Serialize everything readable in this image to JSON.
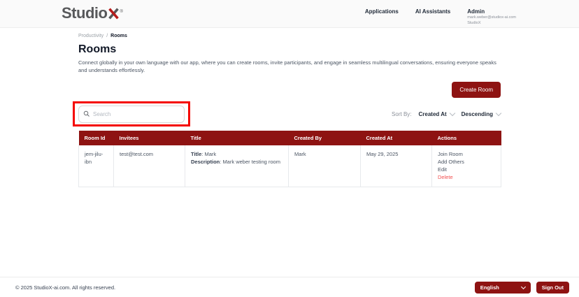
{
  "brand": {
    "name_primary": "Studio",
    "name_accent": "X",
    "registered_mark": "®"
  },
  "nav": {
    "items": [
      {
        "label": "Applications"
      },
      {
        "label": "AI Assistants"
      }
    ],
    "user": {
      "name": "Admin",
      "email": "mark.weber@studiox-ai.com",
      "org": "StudioX"
    }
  },
  "breadcrumb": {
    "parent": "Productivity",
    "separator": "/",
    "current": "Rooms"
  },
  "page": {
    "title": "Rooms",
    "description": "Connect globally in your own language with our app, where you can create rooms, invite participants, and engage in seamless multilingual conversations, ensuring everyone speaks and understands effortlessly.",
    "create_button": "Create Room"
  },
  "search": {
    "placeholder": "Search"
  },
  "sort": {
    "label": "Sort By:",
    "field": "Created At",
    "direction": "Descending"
  },
  "table": {
    "headers": [
      "Room Id",
      "Invitees",
      "Title",
      "Created By",
      "Created At",
      "Actions"
    ],
    "label_separator": ": ",
    "rows": [
      {
        "room_id": "jem-jilu-ibn",
        "invitees": "test@test.com",
        "title_label": "Title",
        "title_value": "Mark",
        "description_label": "Description",
        "description_value": "Mark weber testing room",
        "created_by": "Mark",
        "created_at": "May 29, 2025",
        "actions": [
          "Join Room",
          "Add Others",
          "Edit",
          "Delete"
        ]
      }
    ]
  },
  "footer": {
    "copyright": "© 2025 StudioX-ai.com.  All rights reserved.",
    "language": "English",
    "sign_out": "Sign Out"
  },
  "colors": {
    "maroon": "#8e1312",
    "annotation_red": "#f50500",
    "delete_red": "#f25050",
    "logo_gray": "#58595b"
  }
}
